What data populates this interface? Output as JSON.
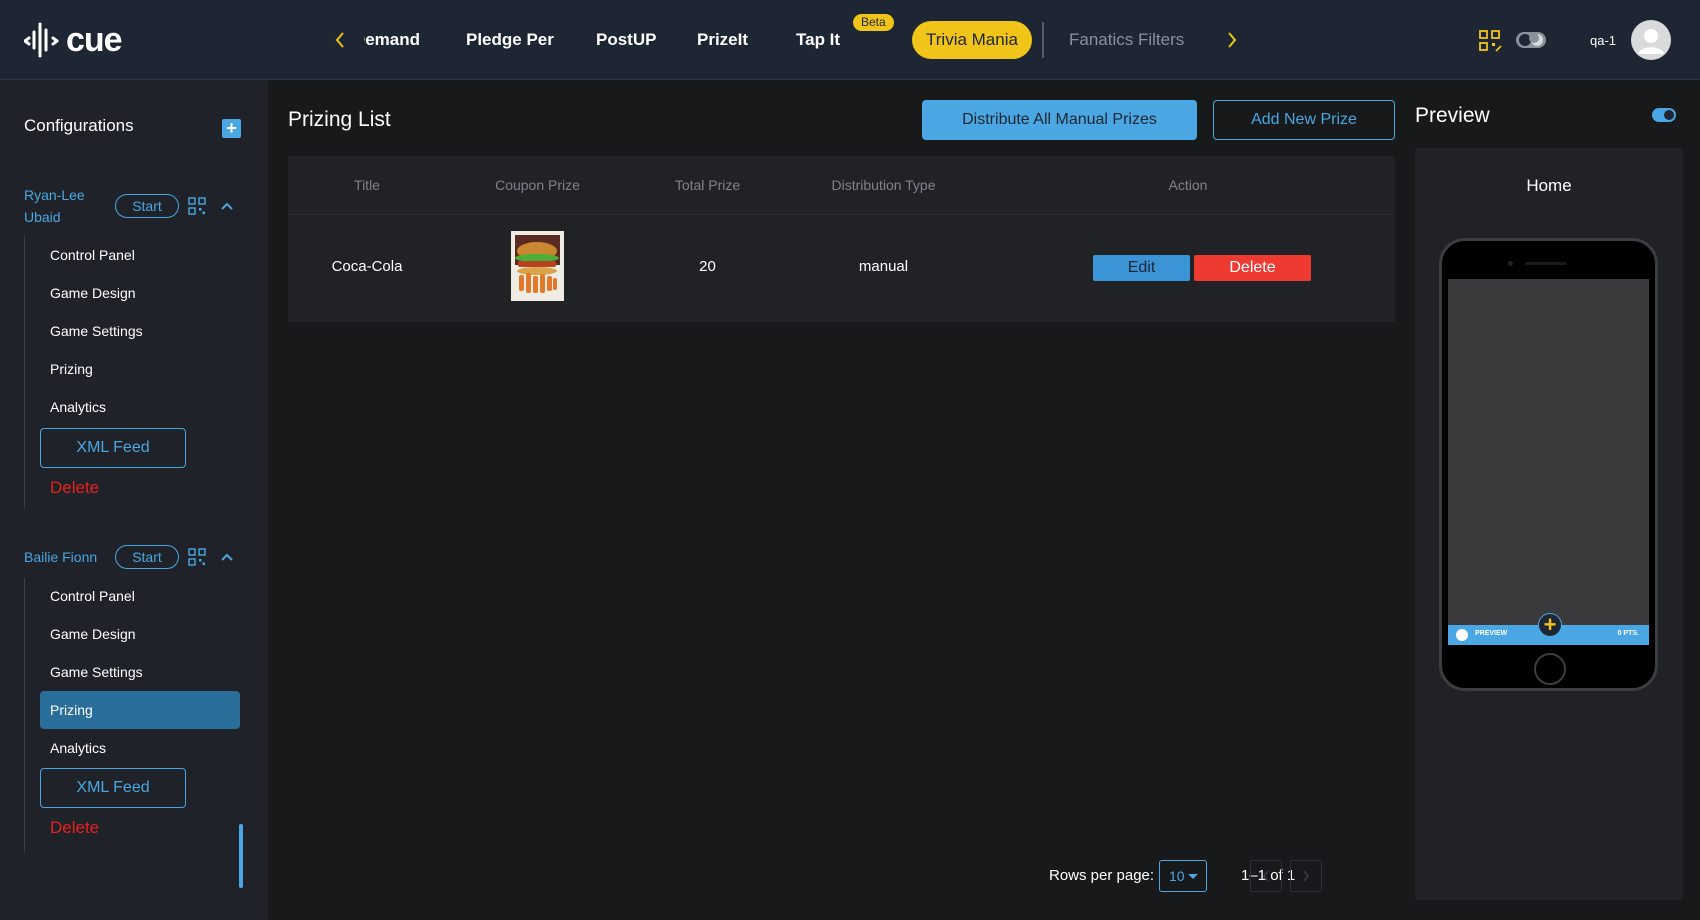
{
  "app": {
    "logo_text": "cue"
  },
  "topnav": {
    "items": [
      {
        "label": "Demand"
      },
      {
        "label": "Pledge Per"
      },
      {
        "label": "PostUP"
      },
      {
        "label": "PrizeIt"
      },
      {
        "label": "Tap It",
        "badge": "Beta"
      },
      {
        "label": "Trivia Mania",
        "active": true
      },
      {
        "label": "Fanatics Filters"
      }
    ],
    "user_label": "qa-1"
  },
  "sidebar": {
    "title": "Configurations",
    "groups": [
      {
        "name": "Ryan-Lee Ubaid",
        "start_label": "Start",
        "items": [
          "Control Panel",
          "Game Design",
          "Game Settings",
          "Prizing",
          "Analytics"
        ],
        "xml_label": "XML Feed",
        "delete_label": "Delete"
      },
      {
        "name": "Bailie Fionn",
        "start_label": "Start",
        "items": [
          "Control Panel",
          "Game Design",
          "Game Settings",
          "Prizing",
          "Analytics"
        ],
        "selected_item": "Prizing",
        "xml_label": "XML Feed",
        "delete_label": "Delete"
      }
    ]
  },
  "main": {
    "title": "Prizing List",
    "distribute_label": "Distribute All Manual Prizes",
    "add_label": "Add New Prize",
    "table": {
      "columns": [
        "Title",
        "Coupon Prize",
        "Total Prize",
        "Distribution Type",
        "Action"
      ],
      "rows": [
        {
          "title": "Coca-Cola",
          "coupon_image": "burger-image",
          "total_prize": "20",
          "distribution_type": "manual",
          "edit_label": "Edit",
          "delete_label": "Delete"
        }
      ]
    },
    "pagination": {
      "rows_per_page_label": "Rows per page:",
      "rows_per_page": "10",
      "range": "1–1 of 1"
    }
  },
  "preview": {
    "title": "Preview",
    "toggle_on": true,
    "screen_title": "Home",
    "bar_label": "PREVIEW",
    "bar_points": "0 PTS."
  },
  "colors": {
    "accent": "#4aa7e3",
    "active_tab": "#f0c419",
    "danger": "#ef3a32",
    "topbar": "#1f2633",
    "background": "#18191b"
  }
}
